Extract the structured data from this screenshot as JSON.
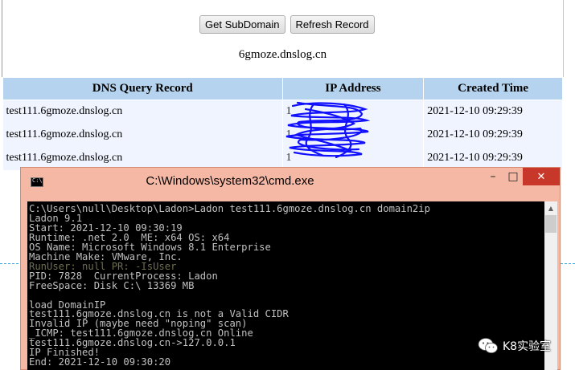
{
  "toolbar": {
    "get_subdomain_label": "Get SubDomain",
    "refresh_record_label": "Refresh Record"
  },
  "subdomain": "6gmoze.dnslog.cn",
  "table": {
    "headers": [
      "DNS Query Record",
      "IP Address",
      "Created Time"
    ],
    "rows": [
      {
        "record": "test111.6gmoze.dnslog.cn",
        "ip": "1",
        "time": "2021-12-10 09:29:39"
      },
      {
        "record": "test111.6gmoze.dnslog.cn",
        "ip": "1",
        "time": "2021-12-10 09:29:39"
      },
      {
        "record": "test111.6gmoze.dnslog.cn",
        "ip": "1",
        "time": "2021-12-10 09:29:39"
      }
    ]
  },
  "cmd": {
    "title": "C:\\Windows\\system32\\cmd.exe",
    "lines_top": [
      "C:\\Users\\null\\Desktop\\Ladon>Ladon test111.6gmoze.dnslog.cn domain2ip",
      "Ladon 9.1",
      "Start: 2021-12-10 09:30:19",
      "Runtime: .net 2.0  ME: x64 OS: x64",
      "OS Name: Microsoft Windows 8.1 Enterprise",
      "Machine Make: VMware, Inc."
    ],
    "line_dim": "RunUser: null PR: -IsUser",
    "lines_bottom": [
      "PID: 7828  CurrentProcess: Ladon",
      "FreeSpace: Disk C:\\ 13369 MB",
      "",
      "load DomainIP",
      "test111.6gmoze.dnslog.cn is not a Valid CIDR",
      "Invalid IP (maybe need \"noping\" scan)",
      "_ICMP: test111.6gmoze.dnslog.cn Online",
      "test111.6gmoze.dnslog.cn->127.0.0.1",
      "IP Finished!",
      "End: 2021-12-10 09:30:20"
    ]
  },
  "watermark": {
    "text": "K8实验室",
    "icon": "wechat-icon"
  },
  "colors": {
    "header_bg": "#b5d3ee",
    "row_bg": "#f0f4ff",
    "titlebar_bg": "#f4b8a5",
    "close_btn": "#c7382a",
    "scribble": "#1010ff"
  }
}
